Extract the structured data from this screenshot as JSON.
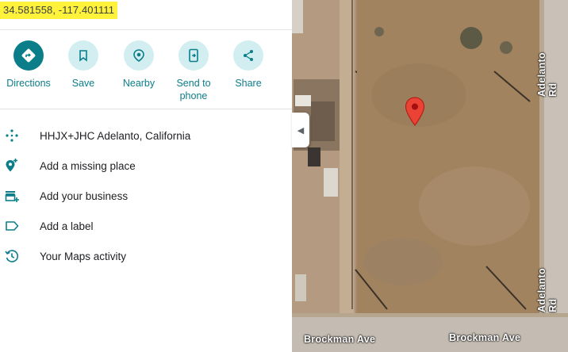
{
  "coordinates": "34.581558, -117.401111",
  "actions": [
    {
      "label": "Directions",
      "icon": "directions-icon"
    },
    {
      "label": "Save",
      "icon": "bookmark-icon"
    },
    {
      "label": "Nearby",
      "icon": "nearby-icon"
    },
    {
      "label": "Send to\nphone",
      "icon": "send-to-phone-icon"
    },
    {
      "label": "Share",
      "icon": "share-icon"
    }
  ],
  "list": [
    {
      "text": "HHJX+JHC Adelanto, California",
      "icon": "plus-code-icon"
    },
    {
      "text": "Add a missing place",
      "icon": "add-place-icon"
    },
    {
      "text": "Add your business",
      "icon": "add-business-icon"
    },
    {
      "text": "Add a label",
      "icon": "label-icon"
    },
    {
      "text": "Your Maps activity",
      "icon": "history-icon"
    }
  ],
  "map": {
    "roads": {
      "adelanto_top": "Adelanto Rd",
      "adelanto_bottom": "Adelanto Rd",
      "brockman_left": "Brockman Ave",
      "brockman_right": "Brockman Ave"
    },
    "pin_color": "#ea4335"
  },
  "colors": {
    "accent": "#0b7e8a",
    "accent_light": "#d2eef0",
    "highlight": "#fff23a"
  }
}
